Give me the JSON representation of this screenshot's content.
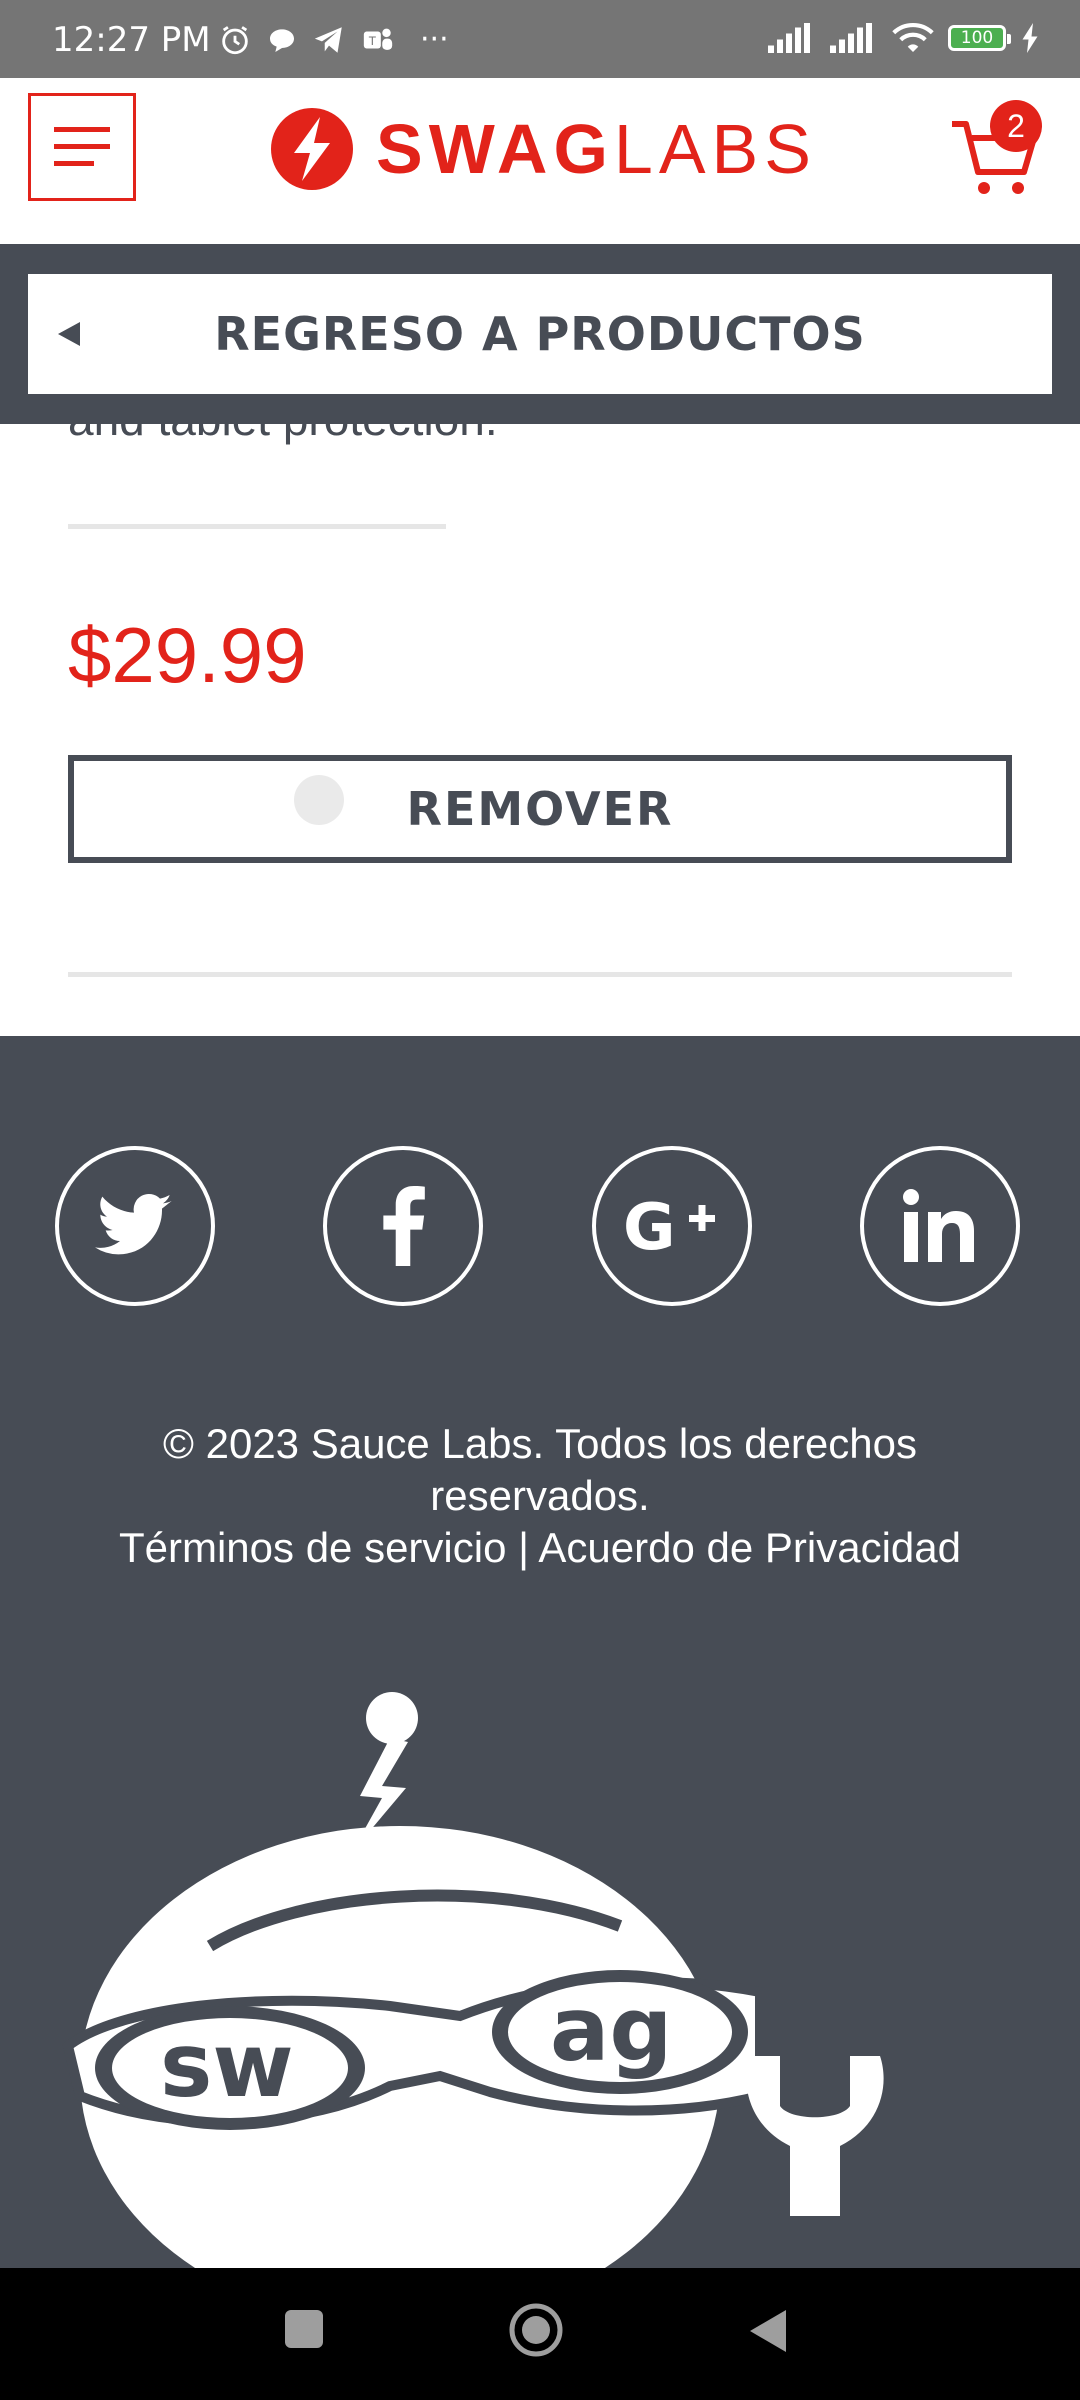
{
  "status_bar": {
    "time": "12:27 PM",
    "overflow": "···",
    "battery": "100"
  },
  "header": {
    "logo_bold": "SWAG",
    "logo_light": "LABS",
    "cart_count": "2"
  },
  "back_bar": {
    "label": "REGRESO A PRODUCTOS"
  },
  "product": {
    "description_fragment": "and tablet protection.",
    "price": "$29.99",
    "remove_label": "REMOVER"
  },
  "footer": {
    "social": [
      "twitter-icon",
      "facebook-icon",
      "google-plus-icon",
      "linkedin-icon"
    ],
    "copyright_line1": "© 2023 Sauce Labs. Todos los derechos",
    "copyright_line2": "reservados.",
    "terms": "Términos de servicio",
    "separator": "|",
    "privacy": "Acuerdo de Privacidad",
    "mascot_text_left": "sw",
    "mascot_text_right": "ag"
  },
  "colors": {
    "accent": "#e2231a",
    "dark": "#474c55",
    "status_bar": "#757575"
  }
}
